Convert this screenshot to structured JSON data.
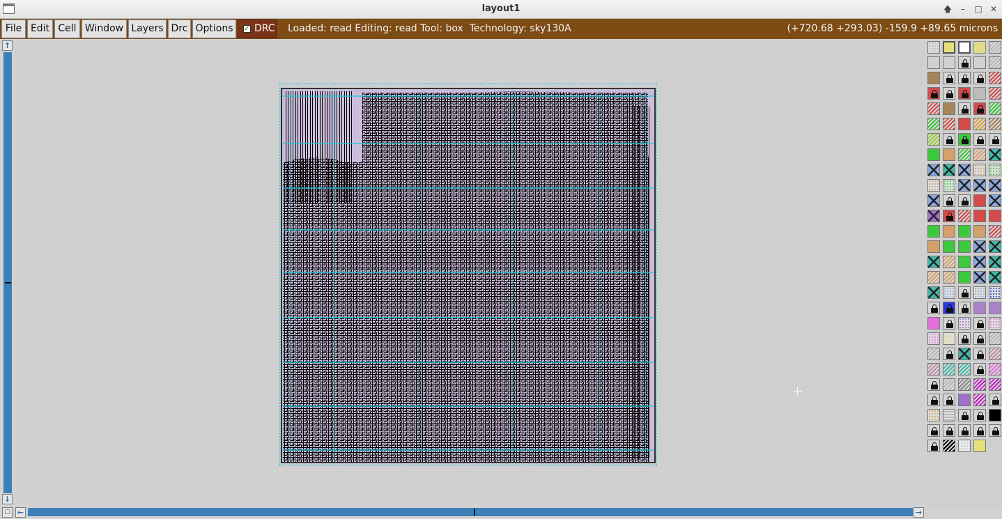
{
  "window": {
    "title": "layout1"
  },
  "menu": {
    "items": [
      "File",
      "Edit",
      "Cell",
      "Window",
      "Layers",
      "Drc",
      "Options"
    ],
    "drc_toggle_label": "DRC",
    "drc_checked": true
  },
  "status": {
    "text": "Loaded: read Editing: read Tool: box  Technology: sky130A",
    "coords": "(+720.68 +293.03) -159.9 +89.65 microns"
  },
  "colors": {
    "menubar": "#7d4b14",
    "drc_toggle": "#7a3218",
    "scrollbar": "#3d7fb9",
    "canvas": "#d0d0d0",
    "layout_fill": "#cbbdd9",
    "layout_lines": "#000000",
    "power_straps": "#1ec8dc"
  },
  "icons": {
    "window_buttons": [
      "arrow-up-icon",
      "minimize-icon",
      "maximize-icon",
      "close-icon"
    ],
    "window_button_glyphs": [
      "🡅",
      "–",
      "□",
      "✕"
    ]
  },
  "layer_palette": [
    [
      "dots-gray",
      "outline-yellow",
      "outline-white",
      "light-yellow",
      "hatch-gray"
    ],
    [
      "hatch-lightgray",
      "hatch-lightgray",
      "lock",
      "hatch-lightgray",
      "hatch-gray"
    ],
    [
      "brown",
      "lock",
      "lock",
      "lock",
      "hatch-red"
    ],
    [
      "lock-red",
      "lock",
      "lock-red",
      "light-gray",
      "hatch-red"
    ],
    [
      "hatch-red",
      "brown",
      "lock",
      "lock-red",
      "hatch-green"
    ],
    [
      "hatch-green",
      "hatch-red",
      "solid-red",
      "hatch-orange",
      "hatch-brown"
    ],
    [
      "hatch-yellowgreen",
      "lock",
      "lock-green",
      "lock",
      "lock"
    ],
    [
      "solid-green",
      "tan",
      "hatch-green",
      "hatch-tan",
      "cross-teal"
    ],
    [
      "cross-blue",
      "cross-teal",
      "cross-blue",
      "dots-tan",
      "dots-green"
    ],
    [
      "dots-tan",
      "dots-green",
      "cross-blue",
      "cross-blue",
      "cross-blue"
    ],
    [
      "cross-blue",
      "lock",
      "lock",
      "solid-red",
      "cross-blue"
    ],
    [
      "cross-purple",
      "lock-red",
      "hatch-red",
      "solid-red",
      "solid-red"
    ],
    [
      "solid-green",
      "tan",
      "solid-green",
      "tan",
      "hatch-red"
    ],
    [
      "tan",
      "solid-green",
      "solid-green",
      "cross-blue",
      "cross-teal"
    ],
    [
      "cross-teal",
      "hatch-tan",
      "solid-green",
      "cross-blue",
      "cross-teal"
    ],
    [
      "hatch-tan",
      "hatch-tan",
      "solid-green",
      "cross-blue",
      "cross-teal"
    ],
    [
      "cross-teal",
      "dots-blue",
      "lock",
      "dots-blue",
      "dots-navy"
    ],
    [
      "lock",
      "lock-navy",
      "lock",
      "light-purple",
      "light-purple"
    ],
    [
      "solid-pink",
      "lock",
      "dots-purple",
      "lock",
      "dots-pink"
    ],
    [
      "dots-pink",
      "dots-yellow",
      "lock",
      "lock",
      "hatch-gray"
    ],
    [
      "hatch-gray",
      "lock",
      "cross-teal",
      "lock",
      "hatch-mauve"
    ],
    [
      "hatch-mauve",
      "hatch-teal",
      "hatch-teal",
      "lock",
      "hatch-pink"
    ],
    [
      "lock",
      "hatch-gray",
      "hatch-darkgray",
      "hatch-magenta",
      "hatch-magenta"
    ],
    [
      "lock",
      "lock",
      "solid-purple",
      "hatch-magenta",
      "lock"
    ],
    [
      "dots-orange",
      "stripes-gray",
      "lock",
      "lock",
      "solid-black"
    ],
    [
      "lock",
      "lock",
      "lock",
      "lock",
      "lock"
    ],
    [
      "lock",
      "hatch-black",
      "dots-white",
      "solid-yellow"
    ]
  ]
}
